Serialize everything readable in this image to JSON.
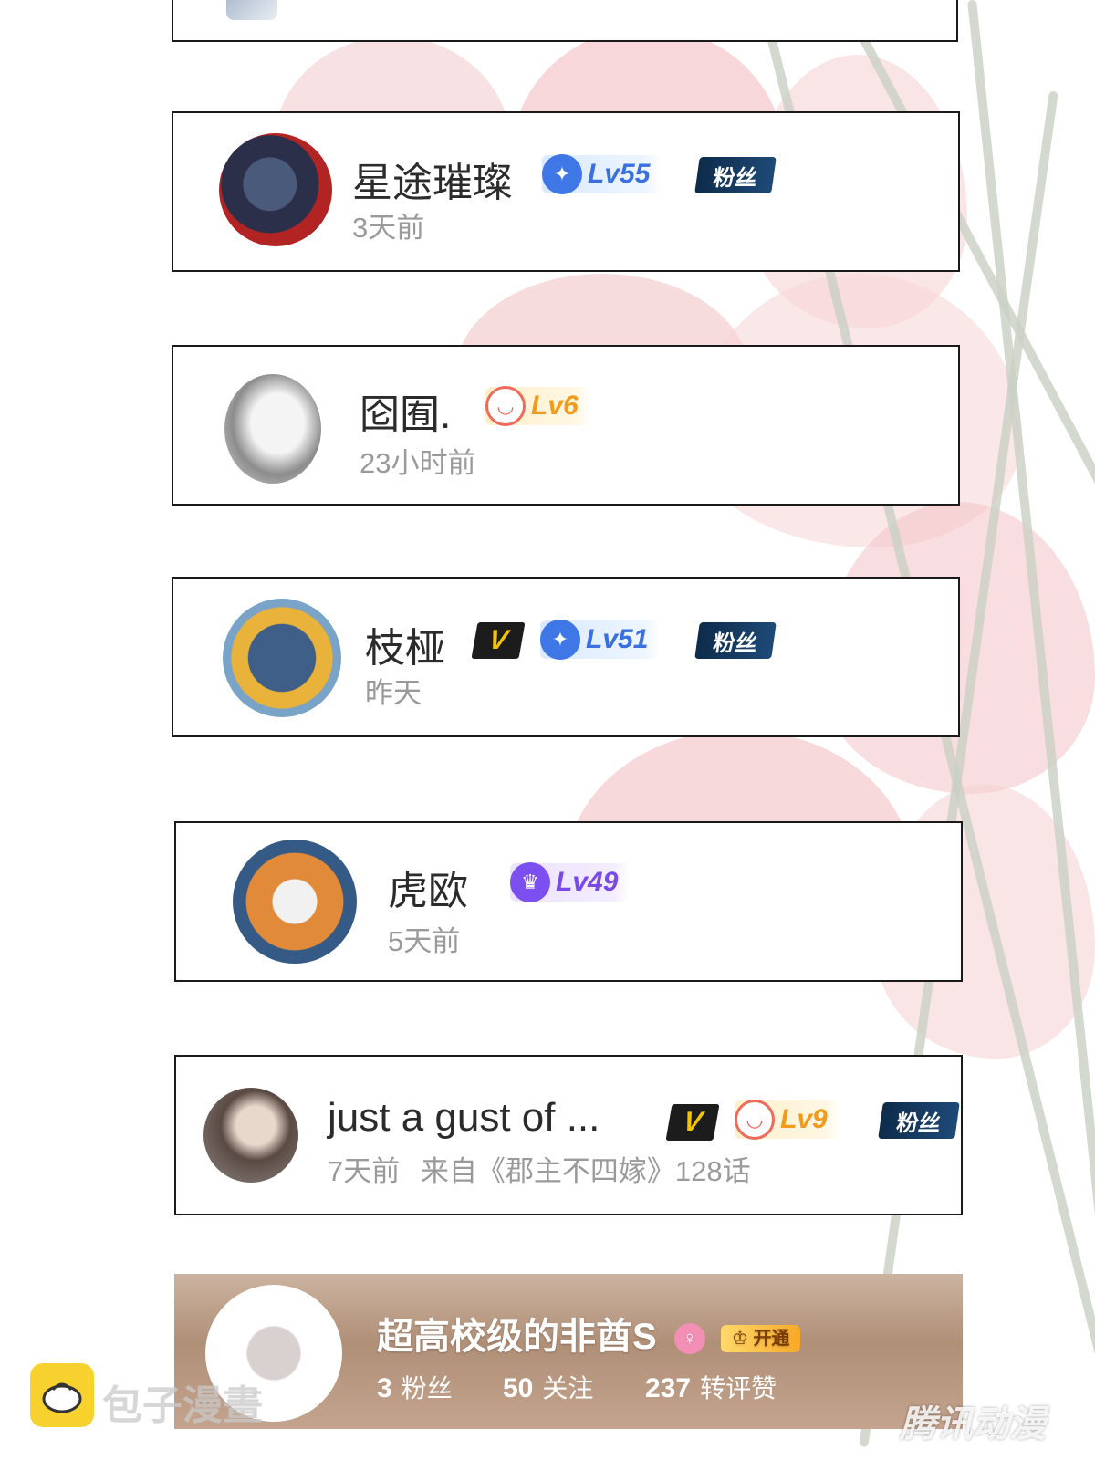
{
  "comments": [
    {
      "username": "星途璀璨",
      "time": "3天前",
      "level": "Lv55",
      "level_style": "blue",
      "fan_badge": "粉丝",
      "vip": false
    },
    {
      "username": "囵囿.",
      "time": "23小时前",
      "level": "Lv6",
      "level_style": "orange",
      "fan_badge": "",
      "vip": false
    },
    {
      "username": "枝桠",
      "time": "昨天",
      "level": "Lv51",
      "level_style": "blue",
      "fan_badge": "粉丝",
      "vip": true,
      "vip_label": "V"
    },
    {
      "username": "虎欧",
      "time": "5天前",
      "level": "Lv49",
      "level_style": "purple",
      "fan_badge": "",
      "vip": false
    },
    {
      "username": "just a gust of ...",
      "time": "7天前",
      "source": "来自《郡主不四嫁》128话",
      "level": "Lv9",
      "level_style": "orange",
      "fan_badge": "粉丝",
      "vip": true,
      "vip_label": "V"
    }
  ],
  "profile_banner": {
    "username": "超高校级的非酋S",
    "open_badge": "开通",
    "stats": [
      {
        "value": "3",
        "label": "粉丝"
      },
      {
        "value": "50",
        "label": "关注"
      },
      {
        "value": "237",
        "label": "转评赞"
      }
    ]
  },
  "watermarks": {
    "site": "包子漫畫",
    "brand": "腾讯动漫"
  },
  "colors": {
    "card_border": "#1a1a1a",
    "username": "#2b2b2b",
    "meta": "#9a9a9a",
    "level_blue": "#3a6fe0",
    "level_orange": "#f29a1c",
    "level_purple": "#7a4ae8",
    "fan_badge": "#0e2b4a",
    "vip_yellow": "#f5c400"
  }
}
